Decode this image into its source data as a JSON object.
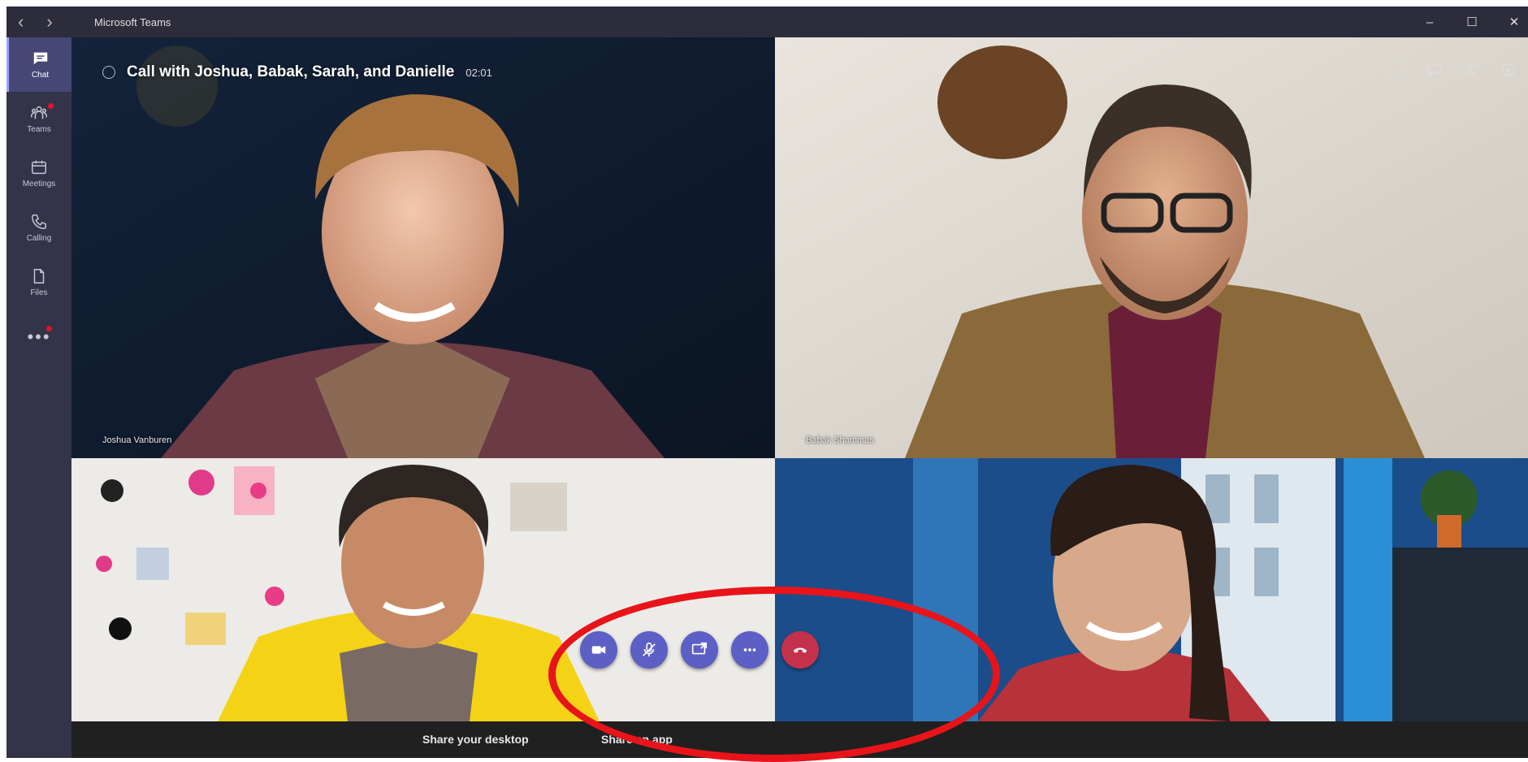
{
  "window": {
    "title": "Microsoft Teams",
    "nav_back": "‹",
    "nav_forward": "›",
    "minimize": "–",
    "maximize": "☐",
    "close": "✕"
  },
  "rail": {
    "items": [
      {
        "label": "Chat",
        "icon": "chat-icon"
      },
      {
        "label": "Teams",
        "icon": "teams-icon",
        "notification": true
      },
      {
        "label": "Meetings",
        "icon": "calendar-icon"
      },
      {
        "label": "Calling",
        "icon": "phone-icon"
      },
      {
        "label": "Files",
        "icon": "file-icon"
      }
    ],
    "more": "•••"
  },
  "call": {
    "title": "Call with Joshua, Babak, Sarah, and Danielle",
    "duration": "02:01",
    "participants": [
      {
        "name": "Joshua Vanburen"
      },
      {
        "name": "Babak Shammas"
      },
      {
        "name": ""
      },
      {
        "name": ""
      }
    ]
  },
  "controls": [
    "video-icon",
    "mic-muted-icon",
    "share-screen-icon",
    "more-options-icon",
    "hang-up-icon"
  ],
  "bottombar": {
    "share_desktop": "Share your desktop",
    "share_app": "Share an app"
  },
  "colors": {
    "rail": "#33344a",
    "accent": "#5c5fc4",
    "hangup": "#c4314b",
    "annotation": "#e8141a"
  }
}
